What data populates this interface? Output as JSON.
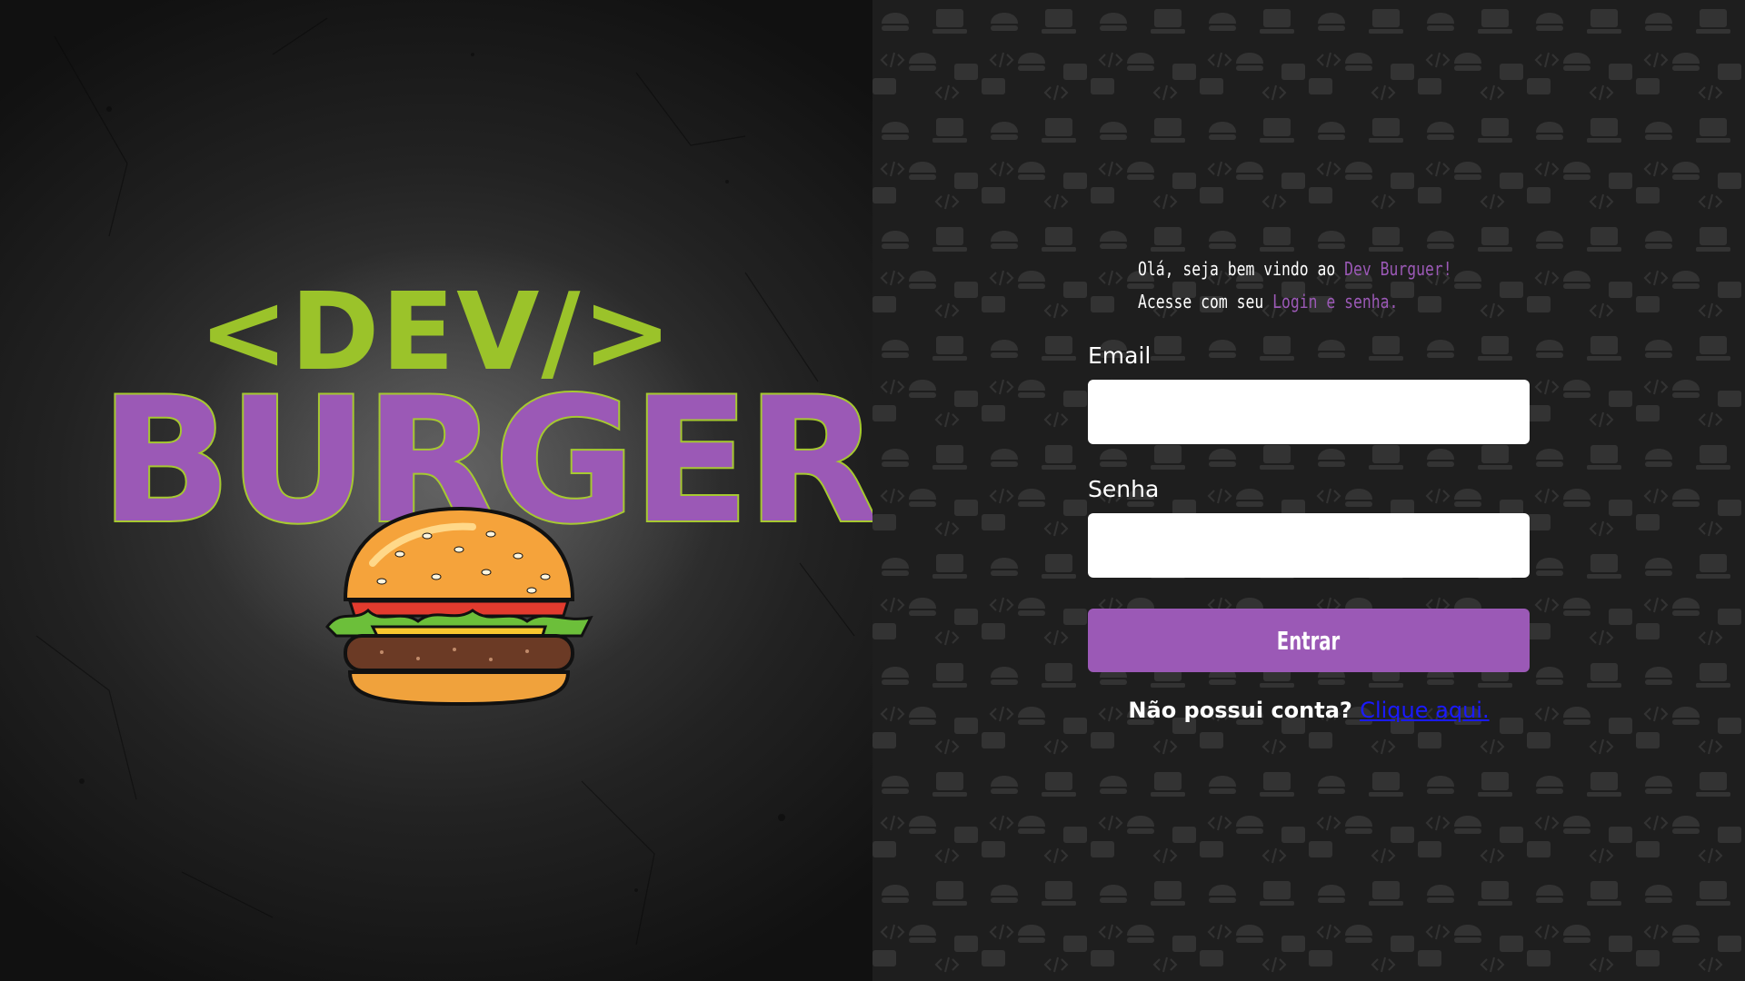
{
  "logo": {
    "line1": "<DEV/>",
    "line2": "BURGER",
    "image": "burger-illustration"
  },
  "welcome": {
    "line1_prefix": "Olá, seja bem vindo ao ",
    "line1_accent": "Dev Burguer!",
    "line2_prefix": "Acesse com seu ",
    "line2_accent": "Login e senha."
  },
  "form": {
    "email_label": "Email",
    "email_value": "",
    "password_label": "Senha",
    "password_value": "",
    "submit_label": "Entrar"
  },
  "signup": {
    "prompt": "Não possui conta?",
    "link": "Clique aqui."
  },
  "colors": {
    "accent": "#9b59b6",
    "logo_green": "#9bc32a",
    "link": "#1a1aff"
  }
}
